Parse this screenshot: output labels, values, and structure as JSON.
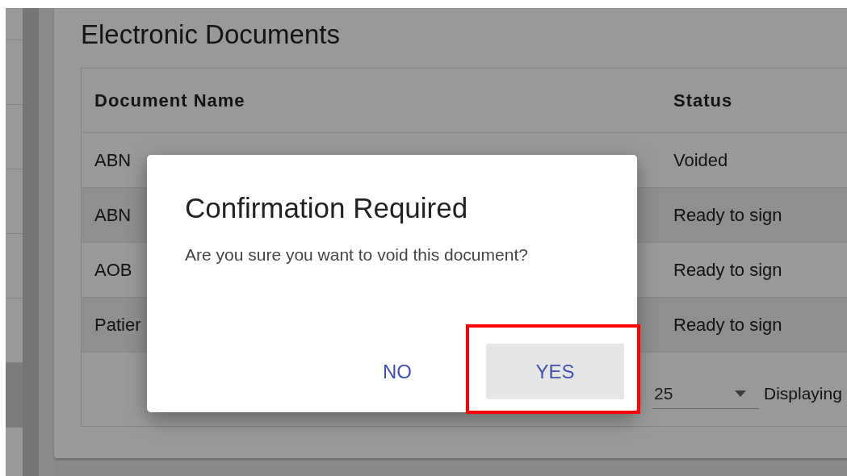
{
  "sidebar": {
    "items": [
      {
        "selected": false
      },
      {
        "selected": false
      },
      {
        "selected": false
      },
      {
        "selected": false
      },
      {
        "selected": false
      },
      {
        "selected": false
      },
      {
        "selected": true
      }
    ]
  },
  "card": {
    "title": "Electronic Documents",
    "table": {
      "columns": [
        "Document Name",
        "Status"
      ],
      "rows": [
        {
          "document_name": "ABN",
          "status": "Voided"
        },
        {
          "document_name": "ABN",
          "status": "Ready to sign"
        },
        {
          "document_name": "AOB",
          "status": "Ready to sign"
        },
        {
          "document_name": "Patier",
          "status": "Ready to sign"
        }
      ],
      "footer": {
        "rows_per_page": "25",
        "displaying": "Displaying"
      }
    }
  },
  "dialog": {
    "title": "Confirmation Required",
    "message": "Are you sure you want to void this document?",
    "buttons": [
      {
        "label": "NO",
        "kind": "text",
        "highlighted": false
      },
      {
        "label": "YES",
        "kind": "filled",
        "highlighted": true
      }
    ]
  }
}
